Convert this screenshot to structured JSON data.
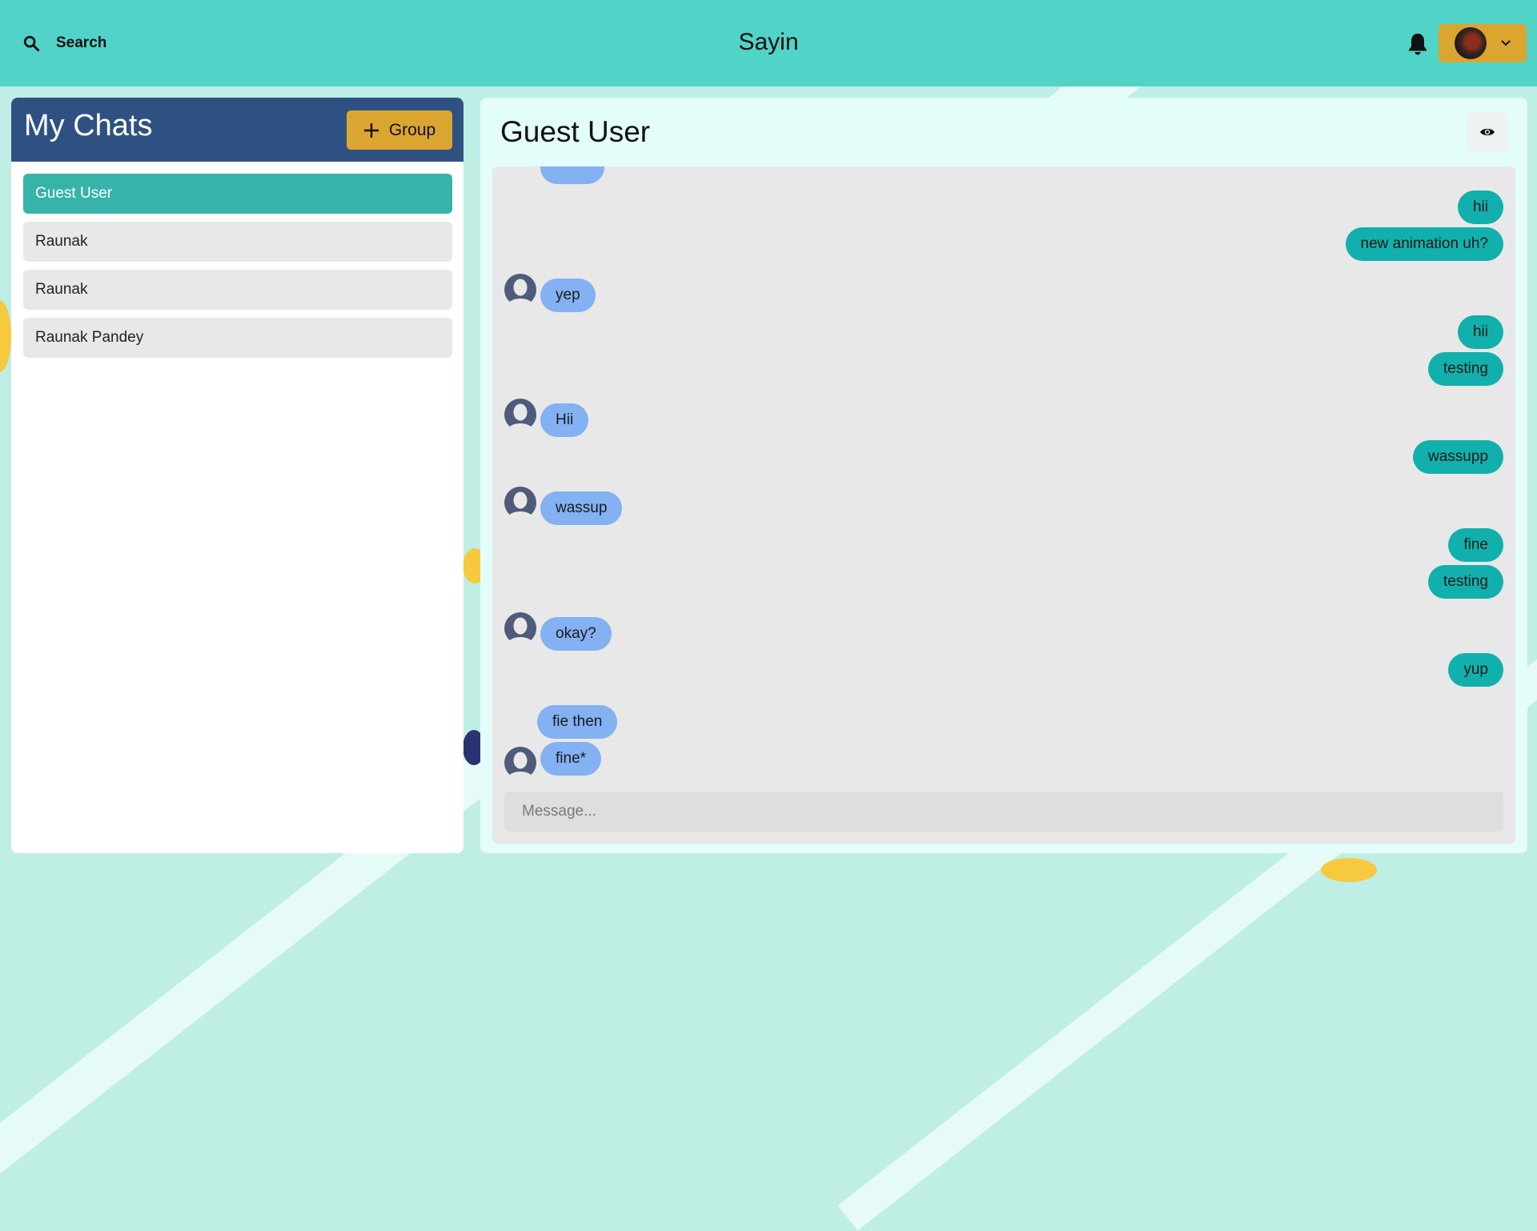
{
  "header": {
    "search_label": "Search",
    "app_title": "Sayin"
  },
  "sidebar": {
    "title": "My Chats",
    "group_button_label": "Group",
    "chats": [
      {
        "name": "Guest User",
        "active": true
      },
      {
        "name": "Raunak",
        "active": false
      },
      {
        "name": "Raunak",
        "active": false
      },
      {
        "name": "Raunak Pandey",
        "active": false
      }
    ]
  },
  "conversation": {
    "title": "Guest User",
    "input_placeholder": "Message...",
    "messages": [
      {
        "text": "hii",
        "from": "me"
      },
      {
        "text": "new animation uh?",
        "from": "me"
      },
      {
        "text": "yep",
        "from": "other"
      },
      {
        "text": "hii",
        "from": "me"
      },
      {
        "text": "testing",
        "from": "me"
      },
      {
        "text": "Hii",
        "from": "other"
      },
      {
        "text": "wassupp",
        "from": "me"
      },
      {
        "text": "wassup",
        "from": "other"
      },
      {
        "text": "fine",
        "from": "me"
      },
      {
        "text": "testing",
        "from": "me"
      },
      {
        "text": "okay?",
        "from": "other"
      },
      {
        "text": "yup",
        "from": "me"
      },
      {
        "text": "fie then",
        "from": "other"
      },
      {
        "text": "fine*",
        "from": "other"
      }
    ]
  },
  "colors": {
    "topbar": "#52d3c7",
    "accent_gold": "#dba630",
    "chats_header": "#2e5182",
    "active_chat": "#37b3aa",
    "my_bubble": "#12b0ac",
    "their_bubble": "#83b1f2"
  },
  "icons": [
    "search-icon",
    "bell-icon",
    "user-avatar",
    "chevron-down-icon",
    "plus-icon",
    "eye-icon",
    "default-avatar-icon"
  ]
}
